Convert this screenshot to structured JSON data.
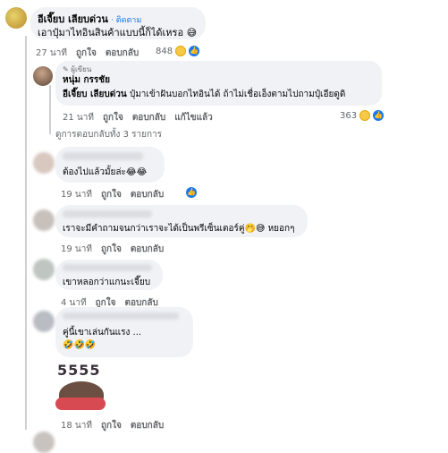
{
  "comment1": {
    "author": "อีเจี๊ยบ เลียบด่วน",
    "follow": "· ติดตาม",
    "text": "เอาปุ๋มาไทอินสินค้าแบบนี้ก็ได้เหรอ 😅",
    "meta": {
      "time": "27 นาที",
      "like": "ถูกใจ",
      "reply": "ตอบกลับ"
    },
    "reaction_count": "848"
  },
  "reply1": {
    "badge": "ผู้เขียน",
    "author": "หนุ่ม กรรชัย",
    "mention": "อีเจี๊ยบ เลียบด่วน",
    "text": "ปุ๋มาเข้าฝันบอกไทอินได้ ถ้าไม่เชื่อเอ็งตามไปถามปุ๋เอียดูดิ",
    "meta": {
      "time": "21 นาที",
      "like": "ถูกใจ",
      "reply": "ตอบกลับ",
      "edited": "แก้ไขแล้ว"
    },
    "reaction_count": "363"
  },
  "all_replies": "ดูการตอบกลับทั้ง 3 รายการ",
  "reply2": {
    "text": "ต้องไปแล้วมั้ยล่ะ😂😂",
    "meta": {
      "time": "19 นาที",
      "like": "ถูกใจ",
      "reply": "ตอบกลับ"
    }
  },
  "reply3": {
    "text": "เราจะมีคำถามจนกว่าเราจะได้เป็นพรีเซ็นเตอร์คู่🤭😅 หยอกๆ",
    "meta": {
      "time": "19 นาที",
      "like": "ถูกใจ",
      "reply": "ตอบกลับ"
    }
  },
  "reply4": {
    "text": "เขาหลอกว่าแกนะเจี๊ยบ",
    "meta": {
      "time": "4 นาที",
      "like": "ถูกใจ",
      "reply": "ตอบกลับ"
    }
  },
  "reply5": {
    "text": "คู่นี้เขาเล่นกันแรง ...",
    "emoji_line": "🤣🤣🤣",
    "sticker_text": "5555",
    "meta": {
      "time": "18 นาที",
      "like": "ถูกใจ",
      "reply": "ตอบกลับ"
    }
  }
}
